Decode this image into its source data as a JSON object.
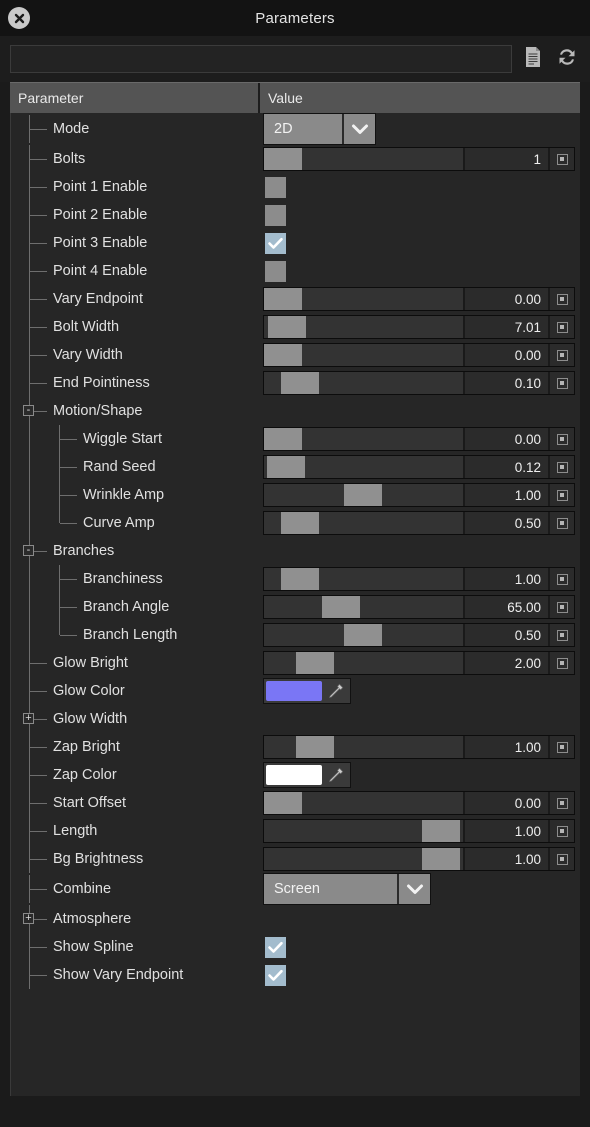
{
  "window": {
    "title": "Parameters",
    "close_icon": "close-icon"
  },
  "toolbar": {
    "search_value": "",
    "search_placeholder": "",
    "buttons": [
      {
        "name": "document-icon",
        "label": "Document"
      },
      {
        "name": "refresh-icon",
        "label": "Refresh"
      }
    ]
  },
  "columns": {
    "parameter": "Parameter",
    "value": "Value"
  },
  "colors": {
    "glow": "#7a76f5",
    "zap": "#ffffff",
    "checkbox_checked": "#a3bccd",
    "checkbox_unchecked": "#8c8c8c",
    "slider_handle": "#909090"
  },
  "rows": [
    {
      "label": "Mode",
      "depth": 1,
      "widget": "dropdown",
      "value": "2D",
      "dd_width": 78,
      "toggle": null
    },
    {
      "label": "Bolts",
      "depth": 1,
      "widget": "slider",
      "value": "1",
      "handle": 0,
      "toggle": null
    },
    {
      "label": "Point 1 Enable",
      "depth": 1,
      "widget": "checkbox",
      "value": false,
      "toggle": null
    },
    {
      "label": "Point 2 Enable",
      "depth": 1,
      "widget": "checkbox",
      "value": false,
      "toggle": null
    },
    {
      "label": "Point 3 Enable",
      "depth": 1,
      "widget": "checkbox",
      "value": true,
      "toggle": null
    },
    {
      "label": "Point 4 Enable",
      "depth": 1,
      "widget": "checkbox",
      "value": false,
      "toggle": null
    },
    {
      "label": "Vary Endpoint",
      "depth": 1,
      "widget": "slider",
      "value": "0.00",
      "handle": 0,
      "toggle": null
    },
    {
      "label": "Bolt Width",
      "depth": 1,
      "widget": "slider",
      "value": "7.01",
      "handle": 4,
      "toggle": null
    },
    {
      "label": "Vary Width",
      "depth": 1,
      "widget": "slider",
      "value": "0.00",
      "handle": 0,
      "toggle": null
    },
    {
      "label": "End Pointiness",
      "depth": 1,
      "widget": "slider",
      "value": "0.10",
      "handle": 17,
      "toggle": null
    },
    {
      "label": "Motion/Shape",
      "depth": 1,
      "widget": "none",
      "value": null,
      "toggle": "-"
    },
    {
      "label": "Wiggle Start",
      "depth": 2,
      "widget": "slider",
      "value": "0.00",
      "handle": 0,
      "toggle": null
    },
    {
      "label": "Rand Seed",
      "depth": 2,
      "widget": "slider",
      "value": "0.12",
      "handle": 3,
      "toggle": null
    },
    {
      "label": "Wrinkle Amp",
      "depth": 2,
      "widget": "slider",
      "value": "1.00",
      "handle": 80,
      "toggle": null
    },
    {
      "label": "Curve Amp",
      "depth": 2,
      "widget": "slider",
      "value": "0.50",
      "handle": 17,
      "toggle": null
    },
    {
      "label": "Branches",
      "depth": 1,
      "widget": "none",
      "value": null,
      "toggle": "-"
    },
    {
      "label": "Branchiness",
      "depth": 2,
      "widget": "slider",
      "value": "1.00",
      "handle": 17,
      "toggle": null
    },
    {
      "label": "Branch Angle",
      "depth": 2,
      "widget": "slider",
      "value": "65.00",
      "handle": 58,
      "toggle": null
    },
    {
      "label": "Branch Length",
      "depth": 2,
      "widget": "slider",
      "value": "0.50",
      "handle": 80,
      "toggle": null
    },
    {
      "label": "Glow Bright",
      "depth": 1,
      "widget": "slider",
      "value": "2.00",
      "handle": 32,
      "toggle": null
    },
    {
      "label": "Glow Color",
      "depth": 1,
      "widget": "color",
      "value": "#7a76f5",
      "toggle": null
    },
    {
      "label": "Glow Width",
      "depth": 1,
      "widget": "none",
      "value": null,
      "toggle": "+"
    },
    {
      "label": "Zap Bright",
      "depth": 1,
      "widget": "slider",
      "value": "1.00",
      "handle": 32,
      "toggle": null
    },
    {
      "label": "Zap Color",
      "depth": 1,
      "widget": "color",
      "value": "#ffffff",
      "toggle": null
    },
    {
      "label": "Start Offset",
      "depth": 1,
      "widget": "slider",
      "value": "0.00",
      "handle": 0,
      "toggle": null
    },
    {
      "label": "Length",
      "depth": 1,
      "widget": "slider",
      "value": "1.00",
      "handle": 158,
      "toggle": null
    },
    {
      "label": "Bg Brightness",
      "depth": 1,
      "widget": "slider",
      "value": "1.00",
      "handle": 158,
      "toggle": null
    },
    {
      "label": "Combine",
      "depth": 1,
      "widget": "dropdown",
      "value": "Screen",
      "dd_width": 133,
      "toggle": null
    },
    {
      "label": "Atmosphere",
      "depth": 1,
      "widget": "none",
      "value": null,
      "toggle": "+"
    },
    {
      "label": "Show Spline",
      "depth": 1,
      "widget": "checkbox",
      "value": true,
      "toggle": null
    },
    {
      "label": "Show Vary Endpoint",
      "depth": 1,
      "widget": "checkbox",
      "value": true,
      "toggle": null
    }
  ]
}
